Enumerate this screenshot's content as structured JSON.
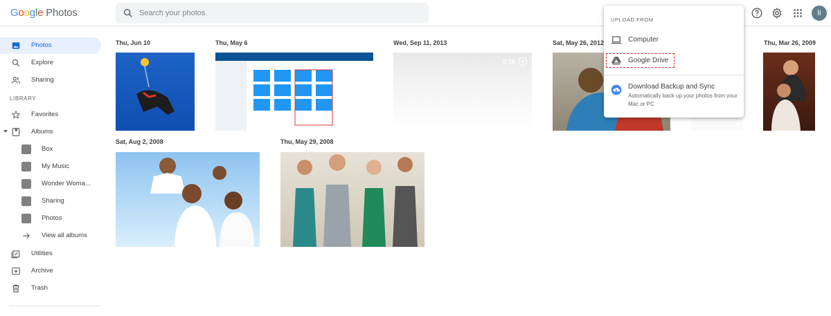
{
  "header": {
    "logo_google": "Google",
    "logo_product": "Photos",
    "search_placeholder": "Search your photos",
    "icons": [
      "help-icon",
      "settings-icon",
      "apps-icon"
    ],
    "avatar_letter": "li"
  },
  "sidebar": {
    "items": [
      {
        "label": "Photos",
        "icon": "photo-icon",
        "active": true
      },
      {
        "label": "Explore",
        "icon": "search-icon"
      },
      {
        "label": "Sharing",
        "icon": "people-icon"
      }
    ],
    "library_title": "LIBRARY",
    "library_items": [
      {
        "label": "Favorites",
        "icon": "star-icon"
      },
      {
        "label": "Albums",
        "icon": "album-icon"
      }
    ],
    "albums": [
      "Box",
      "My Music",
      "Wonder Woma...",
      "Sharing",
      "Photos"
    ],
    "view_all": "View all albums",
    "bottom_items": [
      {
        "label": "Utilities",
        "icon": "utilities-icon"
      },
      {
        "label": "Archive",
        "icon": "archive-icon"
      },
      {
        "label": "Trash",
        "icon": "trash-icon"
      }
    ]
  },
  "main": {
    "dates": [
      "Thu, Jun 10",
      "Thu, May 6",
      "Wed, Sep 11, 2013",
      "Sat, May 26, 2012",
      "Thu, Mar 26, 2009",
      "Sat, Aug 2, 2008",
      "Thu, May 29, 2008"
    ],
    "video_duration": "0:16"
  },
  "upload_menu": {
    "title": "UPLOAD FROM",
    "computer": "Computer",
    "google_drive": "Google Drive",
    "backup_title": "Download Backup and Sync",
    "backup_desc": "Automatically back up your photos from your Mac or PC"
  },
  "colors": {
    "accent": "#1967d2",
    "active_bg": "#e8f0fe",
    "highlight": "#d93025"
  }
}
